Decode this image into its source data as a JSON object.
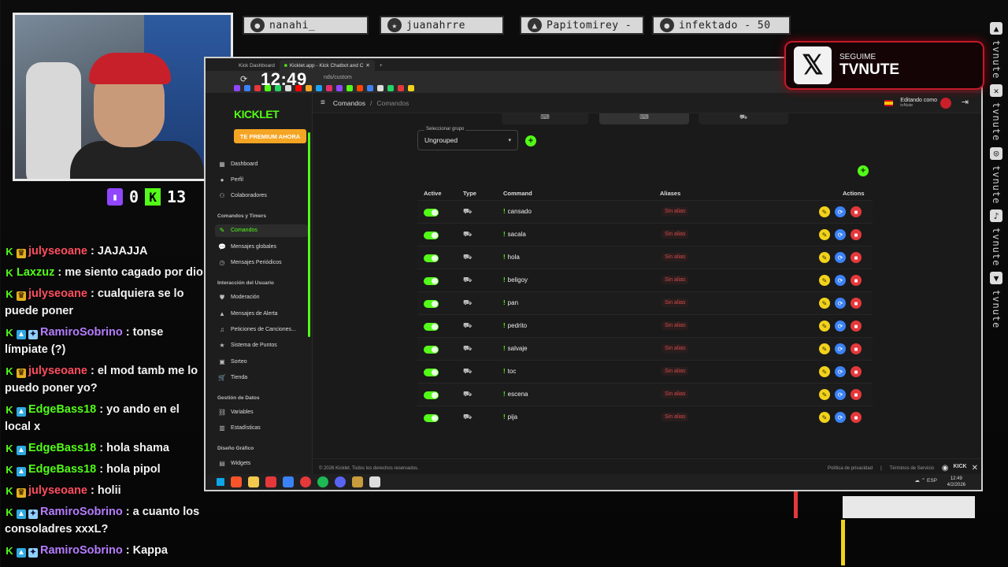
{
  "overlay": {
    "pills": [
      {
        "name": "nanahi_"
      },
      {
        "name": "juanahrre"
      },
      {
        "name": "Papitomirey -"
      },
      {
        "name": "infektado - 50"
      }
    ],
    "counters": {
      "twitch": "0",
      "kick": "13"
    },
    "x_card": {
      "label": "SEGUIME",
      "handle": "TVNUTE"
    },
    "rail_text": "tvnute"
  },
  "chat": [
    {
      "user": "julyseoane",
      "color": "#ff4d5e",
      "badges": [
        "k",
        "crown"
      ],
      "text": ": JAJAJJA"
    },
    {
      "user": "Laxzuz",
      "color": "#53fc18",
      "badges": [
        "k"
      ],
      "text": ": me siento cagado por dio"
    },
    {
      "user": "julyseoane",
      "color": "#ff4d5e",
      "badges": [
        "k",
        "crown"
      ],
      "text": ": cualquiera se lo puede poner"
    },
    {
      "user": "RamiroSobrino",
      "color": "#b57cff",
      "badges": [
        "k",
        "prime",
        "sub"
      ],
      "text": ": tonse límpiate (?)"
    },
    {
      "user": "julyseoane",
      "color": "#ff4d5e",
      "badges": [
        "k",
        "crown"
      ],
      "text": ": el mod tamb me lo puedo poner yo?"
    },
    {
      "user": "EdgeBass18",
      "color": "#53fc18",
      "badges": [
        "k",
        "prime"
      ],
      "text": ": yo ando en el local x"
    },
    {
      "user": "EdgeBass18",
      "color": "#53fc18",
      "badges": [
        "k",
        "prime"
      ],
      "text": ": hola shama"
    },
    {
      "user": "EdgeBass18",
      "color": "#53fc18",
      "badges": [
        "k",
        "prime"
      ],
      "text": ": hola pipol"
    },
    {
      "user": "julyseoane",
      "color": "#ff4d5e",
      "badges": [
        "k",
        "crown"
      ],
      "text": ": holii"
    },
    {
      "user": "RamiroSobrino",
      "color": "#b57cff",
      "badges": [
        "k",
        "prime",
        "sub"
      ],
      "text": ": a cuanto los consoladres xxxL?"
    },
    {
      "user": "RamiroSobrino",
      "color": "#b57cff",
      "badges": [
        "k",
        "prime",
        "sub"
      ],
      "text": ": Kappa"
    }
  ],
  "browser": {
    "tabs": [
      {
        "label": "Kick Dashboard"
      },
      {
        "label": "Kicklet.app - Kick Chatbot and C"
      }
    ],
    "clock": "12:49",
    "url": "nds/custom"
  },
  "app": {
    "brand": "KICKLET",
    "premium": "TE PREMIUM AHORA",
    "sidebar": {
      "top": [
        {
          "label": "Dashboard",
          "icon": "dashboard-icon",
          "glyph": "▦"
        },
        {
          "label": "Perfil",
          "icon": "user-icon",
          "glyph": "●"
        },
        {
          "label": "Colaboradores",
          "icon": "users-icon",
          "glyph": "⚇"
        }
      ],
      "sections": [
        {
          "title": "Comandos y Timers",
          "items": [
            {
              "label": "Comandos",
              "icon": "wrench-icon",
              "glyph": "✎",
              "active": true
            },
            {
              "label": "Mensajes globales",
              "icon": "chat-icon",
              "glyph": "💬"
            },
            {
              "label": "Mensajes Periódicos",
              "icon": "clock-icon",
              "glyph": "◷"
            }
          ]
        },
        {
          "title": "Interacción del Usuario",
          "items": [
            {
              "label": "Moderación",
              "icon": "shield-icon",
              "glyph": "⛊"
            },
            {
              "label": "Mensajes de Alerta",
              "icon": "alert-icon",
              "glyph": "▲"
            },
            {
              "label": "Peticiones de Canciones...",
              "icon": "music-icon",
              "glyph": "♫"
            },
            {
              "label": "Sistema de Puntos",
              "icon": "star-icon",
              "glyph": "★"
            },
            {
              "label": "Sorteo",
              "icon": "gift-icon",
              "glyph": "▣"
            },
            {
              "label": "Tienda",
              "icon": "cart-icon",
              "glyph": "🛒"
            }
          ]
        },
        {
          "title": "Gestión de Datos",
          "items": [
            {
              "label": "Variables",
              "icon": "link-icon",
              "glyph": "⛓"
            },
            {
              "label": "Estadísticas",
              "icon": "chart-icon",
              "glyph": "▥"
            }
          ]
        },
        {
          "title": "Diseño Gráfico",
          "items": [
            {
              "label": "Widgets",
              "icon": "widget-icon",
              "glyph": "▤"
            }
          ]
        }
      ]
    },
    "breadcrumb": {
      "first": "Comandos",
      "sep": "/",
      "current": "Comandos"
    },
    "editing": {
      "label": "Editando como",
      "user": "tvNute"
    },
    "group_select": {
      "label": "Seleccionar grupo",
      "value": "Ungrouped"
    },
    "table": {
      "headers": {
        "active": "Active",
        "type": "Type",
        "command": "Command",
        "aliases": "Aliases",
        "actions": "Actions"
      },
      "rows": [
        {
          "command": "cansado",
          "aliases": "Sin alias"
        },
        {
          "command": "sacala",
          "aliases": "Sin alias"
        },
        {
          "command": "hola",
          "aliases": "Sin alias"
        },
        {
          "command": "beligoy",
          "aliases": "Sin alias"
        },
        {
          "command": "pan",
          "aliases": "Sin alias"
        },
        {
          "command": "pedrito",
          "aliases": "Sin alias"
        },
        {
          "command": "salvaje",
          "aliases": "Sin alias"
        },
        {
          "command": "toc",
          "aliases": "Sin alias"
        },
        {
          "command": "escena",
          "aliases": "Sin alias"
        },
        {
          "command": "pija",
          "aliases": "Sin alias"
        }
      ]
    },
    "footer": {
      "copyright": "© 2026 Kicklet. Todos los derechos reservados.",
      "privacy": "Política de privacidad",
      "sep": "|",
      "terms": "Términos de Servicio"
    }
  },
  "taskbar": {
    "lang": "ESP",
    "time": "12:49",
    "date": "4/2/2026"
  },
  "colors": {
    "accent": "#53fc18",
    "premium": "#f5a524",
    "x_border": "#c01a2a"
  }
}
